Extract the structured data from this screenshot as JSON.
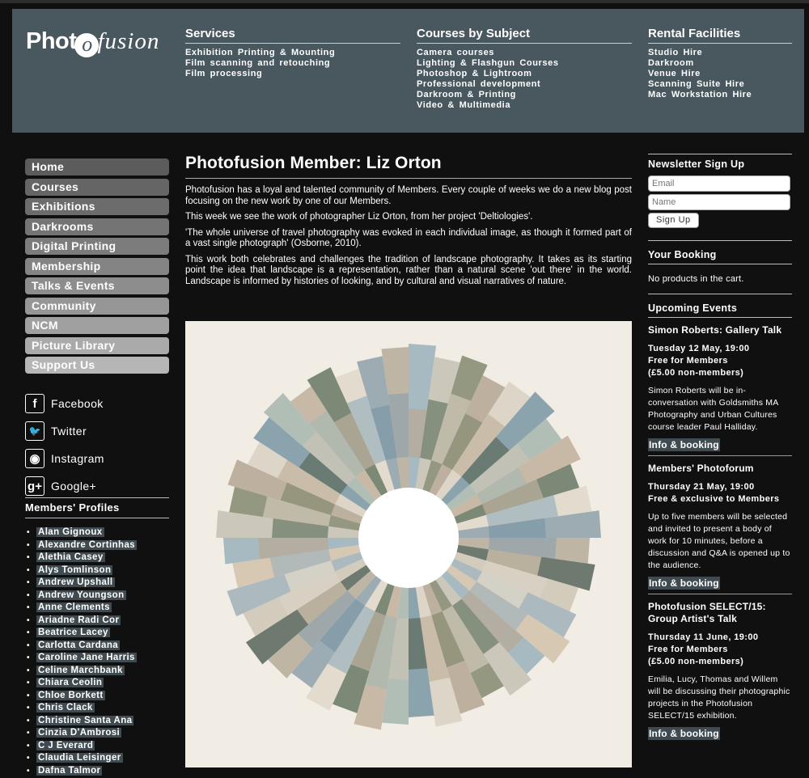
{
  "header": {
    "logo_text": "Photofusion",
    "columns": [
      {
        "title": "Services",
        "links": [
          "Exhibition Printing & Mounting",
          "Film scanning and retouching",
          "Film processing"
        ]
      },
      {
        "title": "Courses by Subject",
        "links": [
          "Camera courses",
          "Lighting & Flashgun Courses",
          "Photoshop & Lightroom",
          "Professional development",
          "Darkroom & Printing",
          "Video & Multimedia"
        ]
      },
      {
        "title": "Rental Facilities",
        "links": [
          "Studio Hire",
          "Darkroom",
          "Venue Hire",
          "Scanning Suite Hire",
          "Mac Workstation Hire"
        ]
      }
    ]
  },
  "sidebar": {
    "nav": [
      {
        "label": "Home",
        "color": "#5c5c5c"
      },
      {
        "label": "Courses",
        "color": "#656565"
      },
      {
        "label": "Exhibitions",
        "color": "#6c6c6c"
      },
      {
        "label": "Darkrooms",
        "color": "#747474"
      },
      {
        "label": "Digital Printing",
        "color": "#7c7c7c"
      },
      {
        "label": "Membership",
        "color": "#848484"
      },
      {
        "label": "Talks & Events",
        "color": "#8d8d8d"
      },
      {
        "label": "Community",
        "color": "#969696"
      },
      {
        "label": "NCM",
        "color": "#a0a0a0"
      },
      {
        "label": "Picture Library",
        "color": "#aaaaaa"
      },
      {
        "label": "Support Us",
        "color": "#b6b6b6"
      }
    ],
    "social": [
      {
        "label": "Facebook",
        "icon": "facebook-icon",
        "glyph": "f"
      },
      {
        "label": "Twitter",
        "icon": "twitter-icon",
        "glyph": "🐦"
      },
      {
        "label": "Instagram",
        "icon": "instagram-icon",
        "glyph": "◉"
      },
      {
        "label": "Google+",
        "icon": "google-plus-icon",
        "glyph": "g+"
      }
    ],
    "members_heading": "Members' Profiles",
    "members": [
      "Alan Gignoux",
      "Alexandre Cortinhas",
      "Alethia Casey",
      "Alys Tomlinson",
      "Andrew Upshall",
      "Andrew Youngson",
      "Anne Clements",
      "Ariadne Radi Cor",
      "Beatrice Lacey",
      "Carlotta Cardana",
      "Caroline Jane Harris",
      "Celine Marchbank",
      "Chiara Ceolin",
      "Chloe Borkett",
      "Chris Clack",
      "Christine Santa Ana",
      "Cinzia D'Ambrosi",
      "C J Everard",
      "Claudia Leisinger",
      "Dafna Talmor"
    ]
  },
  "main": {
    "title": "Photofusion Member: Liz Orton",
    "paragraphs": [
      "Photofusion has a loyal and talented community of Members. Every couple of weeks we do a new blog post focusing on the new work by one of our Members.",
      "This week we see the work of photographer Liz Orton, from her project 'Deltiologies'.",
      "'The whole universe of travel photography was evoked in each individual image, as though it formed part of a vast single photograph' (Osborne, 2010).",
      "This work both celebrates and challenges the tradition of landscape photography. It takes as its starting point the idea that landscape is a representation, rather than a natural scene 'out there' in the world. Landscape is informed by histories of looking, and by cultural and visual narratives of nature."
    ]
  },
  "right": {
    "newsletter_heading": "Newsletter Sign Up",
    "email_placeholder": "Email",
    "name_placeholder": "Name",
    "signup_label": "Sign Up",
    "booking_heading": "Your Booking",
    "booking_text": "No products in the cart.",
    "events_heading": "Upcoming Events",
    "events": [
      {
        "title": "Simon Roberts: Gallery Talk",
        "when": [
          "Tuesday 12 May, 19:00",
          "Free for Members",
          "(£5.00 non-members)"
        ],
        "desc": "Simon Roberts will be in-conversation with Goldsmiths MA Photography and Urban Cultures course leader Paul Halliday.",
        "link": "Info & booking"
      },
      {
        "title": "Members' Photoforum",
        "when": [
          "Thursday 21 May, 19:00",
          "Free & exclusive to Members"
        ],
        "desc": "Up to five members will be selected and invited to present a body of work for 10 minutes, before a discussion and Q&A is opened up to the audience.",
        "link": "Info & booking"
      },
      {
        "title": "Photofusion SELECT/15: Group Artist's Talk",
        "when": [
          "Thursday 11 June, 19:00",
          "Free for Members",
          "(£5.00 non-members)"
        ],
        "desc": "Emilia, Lucy, Thomas and Willem will be discussing their photographic projects in the Photofusion SELECT/15 exhibition.",
        "link": "Info & booking"
      }
    ]
  },
  "colors": {
    "header_bg": "#49575f",
    "page_bg": "#101010",
    "highlight": "#3f4b51",
    "artwork_bg": "#f2ede4"
  }
}
